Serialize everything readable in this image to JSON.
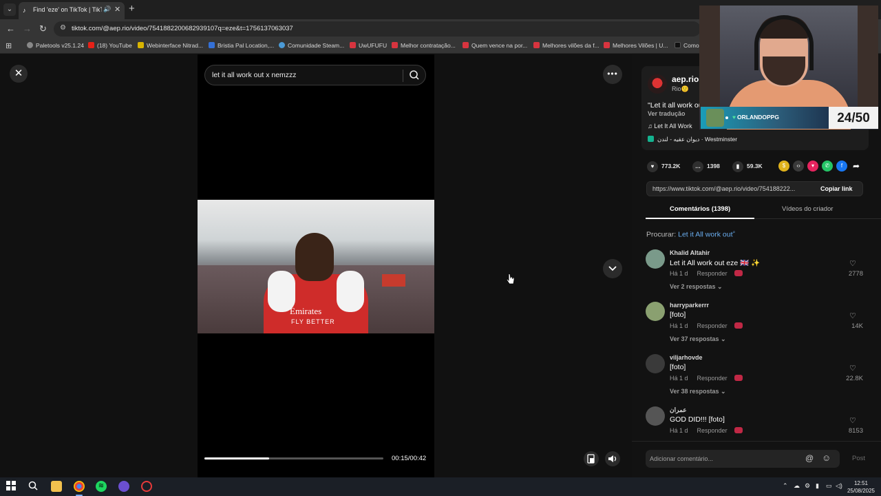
{
  "browser": {
    "tab_title": "Find 'eze' on TikTok | TikTok",
    "url": "tiktok.com/@aep.rio/video/7541882200682939107q=eze&t=1756137063037",
    "bookmarks": [
      {
        "label": "Paletools v25.1.24",
        "color": "#888888"
      },
      {
        "label": "(18) YouTube",
        "color": "#e62117"
      },
      {
        "label": "Webinterface Nitrad...",
        "color": "#d9b400"
      },
      {
        "label": "Bristia Pal Location,...",
        "color": "#3470d6"
      },
      {
        "label": "Comunidade Steam...",
        "color": "#4b9ad6"
      },
      {
        "label": "UwUFUFU",
        "color": "#d8343f"
      },
      {
        "label": "Melhor contratação...",
        "color": "#d8343f"
      },
      {
        "label": "Quem vence na por...",
        "color": "#d8343f"
      },
      {
        "label": "Melhores vilões da f...",
        "color": "#d8343f"
      },
      {
        "label": "Melhores Vilões | U...",
        "color": "#d8343f"
      },
      {
        "label": "Como",
        "color": "#111111"
      }
    ]
  },
  "player": {
    "search_query": "let it all work out x nemzzz",
    "video_text_1": "Emirates",
    "video_text_2": "FLY BETTER",
    "time": "00:15/00:42",
    "progress": 0.36
  },
  "details": {
    "username": "aep.rio",
    "subline": "Rio🙂",
    "description": "\"Let it all work ou",
    "translate": "Ver tradução",
    "music": "♫  Let It All Work",
    "location": "ديوان عقيه - لندن · Westminster",
    "likes": "773.2K",
    "comments": "1398",
    "saves": "59.3K",
    "link": "https://www.tiktok.com/@aep.rio/video/754188222...",
    "copy_link": "Copiar link",
    "tab_comments": "Comentários (1398)",
    "tab_creator": "Vídeos do criador",
    "search_prefix": "Procurar:",
    "search_term": "Let it All work out"
  },
  "comments": [
    {
      "user": "Khalid Altahir",
      "text": "Let it All work out eze 🇬🇧 ✨",
      "age": "Há 1 d",
      "reply": "Responder",
      "more": "Ver 2 respostas ⌄",
      "likes": "2778",
      "avatar": "#7a9a8a"
    },
    {
      "user": "harryparkerrr",
      "text": "[foto]",
      "age": "Há 1 d",
      "reply": "Responder",
      "more": "Ver 37 respostas ⌄",
      "likes": "14K",
      "avatar": "#8aa070"
    },
    {
      "user": "viljarhovde",
      "text": "[foto]",
      "age": "Há 1 d",
      "reply": "Responder",
      "more": "Ver 38 respostas ⌄",
      "likes": "22.8K",
      "avatar": "#3a3a3a"
    },
    {
      "user": "عمران",
      "text": "GOD DID!!! [foto]",
      "age": "Há 1 d",
      "reply": "Responder",
      "more": "",
      "likes": "8153",
      "avatar": "#555555"
    }
  ],
  "comment_box": {
    "placeholder": "Adicionar comentário...",
    "post": "Post"
  },
  "overlay": {
    "name": "ORLANDOPPG",
    "counter": "24/50"
  },
  "taskbar": {
    "time": "12:51",
    "date": "25/08/2025"
  },
  "colors": {
    "accent_link": "#6aaef0",
    "badge": "#c02845"
  }
}
